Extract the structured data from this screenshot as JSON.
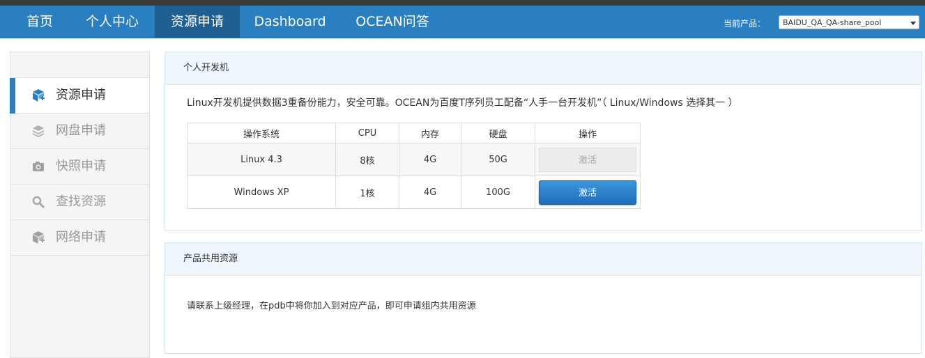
{
  "nav": {
    "items": [
      {
        "label": "首页"
      },
      {
        "label": "个人中心"
      },
      {
        "label": "资源申请"
      },
      {
        "label": "Dashboard"
      },
      {
        "label": "OCEAN问答"
      }
    ],
    "active_index": 2,
    "product_label": "当前产品：",
    "product_value": "BAIDU_QA_QA-share_pool"
  },
  "sidebar": {
    "items": [
      {
        "label": "资源申请",
        "icon": "cube-add-icon"
      },
      {
        "label": "网盘申请",
        "icon": "layers-icon"
      },
      {
        "label": "快照申请",
        "icon": "camera-icon"
      },
      {
        "label": "查找资源",
        "icon": "search-icon"
      },
      {
        "label": "网络申请",
        "icon": "network-cube-icon"
      }
    ],
    "active_index": 0
  },
  "dev_panel": {
    "title": "个人开发机",
    "description": "Linux开发机提供数据3重备份能力，安全可靠。OCEAN为百度T序列员工配备“人手一台开发机”（ Linux/Windows 选择其一 ）",
    "columns": [
      "操作系统",
      "CPU",
      "内存",
      "硬盘",
      "操作"
    ],
    "rows": [
      {
        "os": "Linux 4.3",
        "cpu": "8核",
        "mem": "4G",
        "disk": "50G",
        "action": "激活",
        "enabled": false
      },
      {
        "os": "Windows XP",
        "cpu": "1核",
        "mem": "4G",
        "disk": "100G",
        "action": "激活",
        "enabled": true
      }
    ]
  },
  "shared_panel": {
    "title": "产品共用资源",
    "text": "请联系上级经理，在pdb中将你加入到对应产品，即可申请组内共用资源"
  },
  "colors": {
    "nav_bg": "#2a7fc0",
    "nav_active": "#1f5f91",
    "panel_head_bg": "#eef5fb",
    "primary_button": "#2a7fc0"
  }
}
